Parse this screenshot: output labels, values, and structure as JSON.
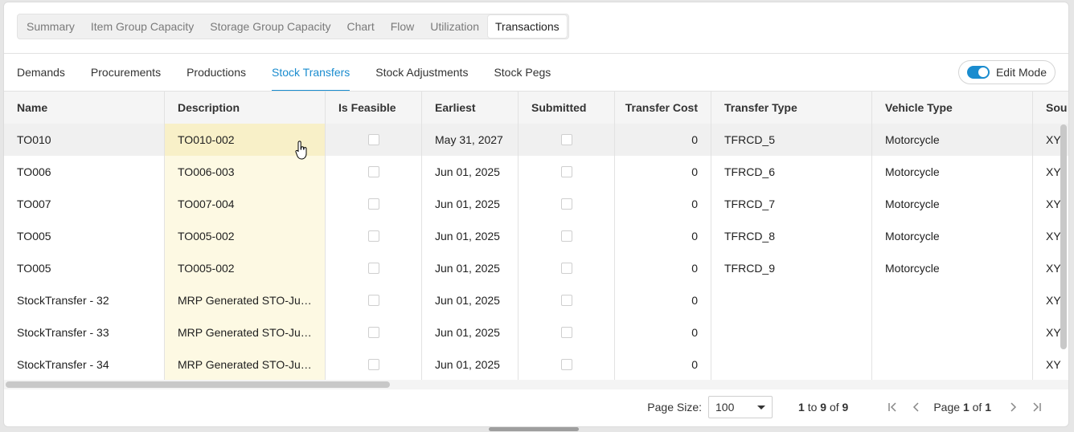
{
  "top_tabs": [
    "Summary",
    "Item Group Capacity",
    "Storage Group Capacity",
    "Chart",
    "Flow",
    "Utilization",
    "Transactions"
  ],
  "top_active": "Transactions",
  "sub_tabs": [
    "Demands",
    "Procurements",
    "Productions",
    "Stock Transfers",
    "Stock Adjustments",
    "Stock Pegs"
  ],
  "sub_active": "Stock Transfers",
  "edit_mode": {
    "label": "Edit Mode",
    "on": true
  },
  "columns": [
    "Name",
    "Description",
    "Is Feasible",
    "Earliest",
    "Submitted",
    "Transfer Cost",
    "Transfer Type",
    "Vehicle Type",
    "Sou"
  ],
  "rows": [
    {
      "name": "TO010",
      "description": "TO010-002",
      "is_feasible": false,
      "earliest": "May 31, 2027",
      "submitted": false,
      "transfer_cost": "0",
      "transfer_type": "TFRCD_5",
      "vehicle_type": "Motorcycle",
      "source": "XY"
    },
    {
      "name": "TO006",
      "description": "TO006-003",
      "is_feasible": false,
      "earliest": "Jun 01, 2025",
      "submitted": false,
      "transfer_cost": "0",
      "transfer_type": "TFRCD_6",
      "vehicle_type": "Motorcycle",
      "source": "XY"
    },
    {
      "name": "TO007",
      "description": "TO007-004",
      "is_feasible": false,
      "earliest": "Jun 01, 2025",
      "submitted": false,
      "transfer_cost": "0",
      "transfer_type": "TFRCD_7",
      "vehicle_type": "Motorcycle",
      "source": "XY"
    },
    {
      "name": "TO005",
      "description": "TO005-002",
      "is_feasible": false,
      "earliest": "Jun 01, 2025",
      "submitted": false,
      "transfer_cost": "0",
      "transfer_type": "TFRCD_8",
      "vehicle_type": "Motorcycle",
      "source": "XY"
    },
    {
      "name": "TO005",
      "description": "TO005-002",
      "is_feasible": false,
      "earliest": "Jun 01, 2025",
      "submitted": false,
      "transfer_cost": "0",
      "transfer_type": "TFRCD_9",
      "vehicle_type": "Motorcycle",
      "source": "XY"
    },
    {
      "name": "StockTransfer - 32",
      "description": "MRP Generated STO-Jun ...",
      "is_feasible": false,
      "earliest": "Jun 01, 2025",
      "submitted": false,
      "transfer_cost": "0",
      "transfer_type": "",
      "vehicle_type": "",
      "source": "XY"
    },
    {
      "name": "StockTransfer - 33",
      "description": "MRP Generated STO-Jun ...",
      "is_feasible": false,
      "earliest": "Jun 01, 2025",
      "submitted": false,
      "transfer_cost": "0",
      "transfer_type": "",
      "vehicle_type": "",
      "source": "XY"
    },
    {
      "name": "StockTransfer - 34",
      "description": "MRP Generated STO-Jun ...",
      "is_feasible": false,
      "earliest": "Jun 01, 2025",
      "submitted": false,
      "transfer_cost": "0",
      "transfer_type": "",
      "vehicle_type": "",
      "source": "XY"
    }
  ],
  "selected_row": 0,
  "footer": {
    "page_size_label": "Page Size:",
    "page_size_value": "100",
    "range_from": "1",
    "range_to_word": "to",
    "range_to": "9",
    "range_of_word": "of",
    "range_total": "9",
    "page_word": "Page",
    "page_current": "1",
    "page_of_word": "of",
    "page_total": "1"
  },
  "icons": {
    "first": "first-page-icon",
    "prev": "previous-page-icon",
    "next": "next-page-icon",
    "last": "last-page-icon",
    "cursor": "hand-pointer-icon"
  },
  "colors": {
    "accent": "#1a8ccf",
    "description_column": "#fdf9e3",
    "selected_row": "#f0f0f0"
  }
}
